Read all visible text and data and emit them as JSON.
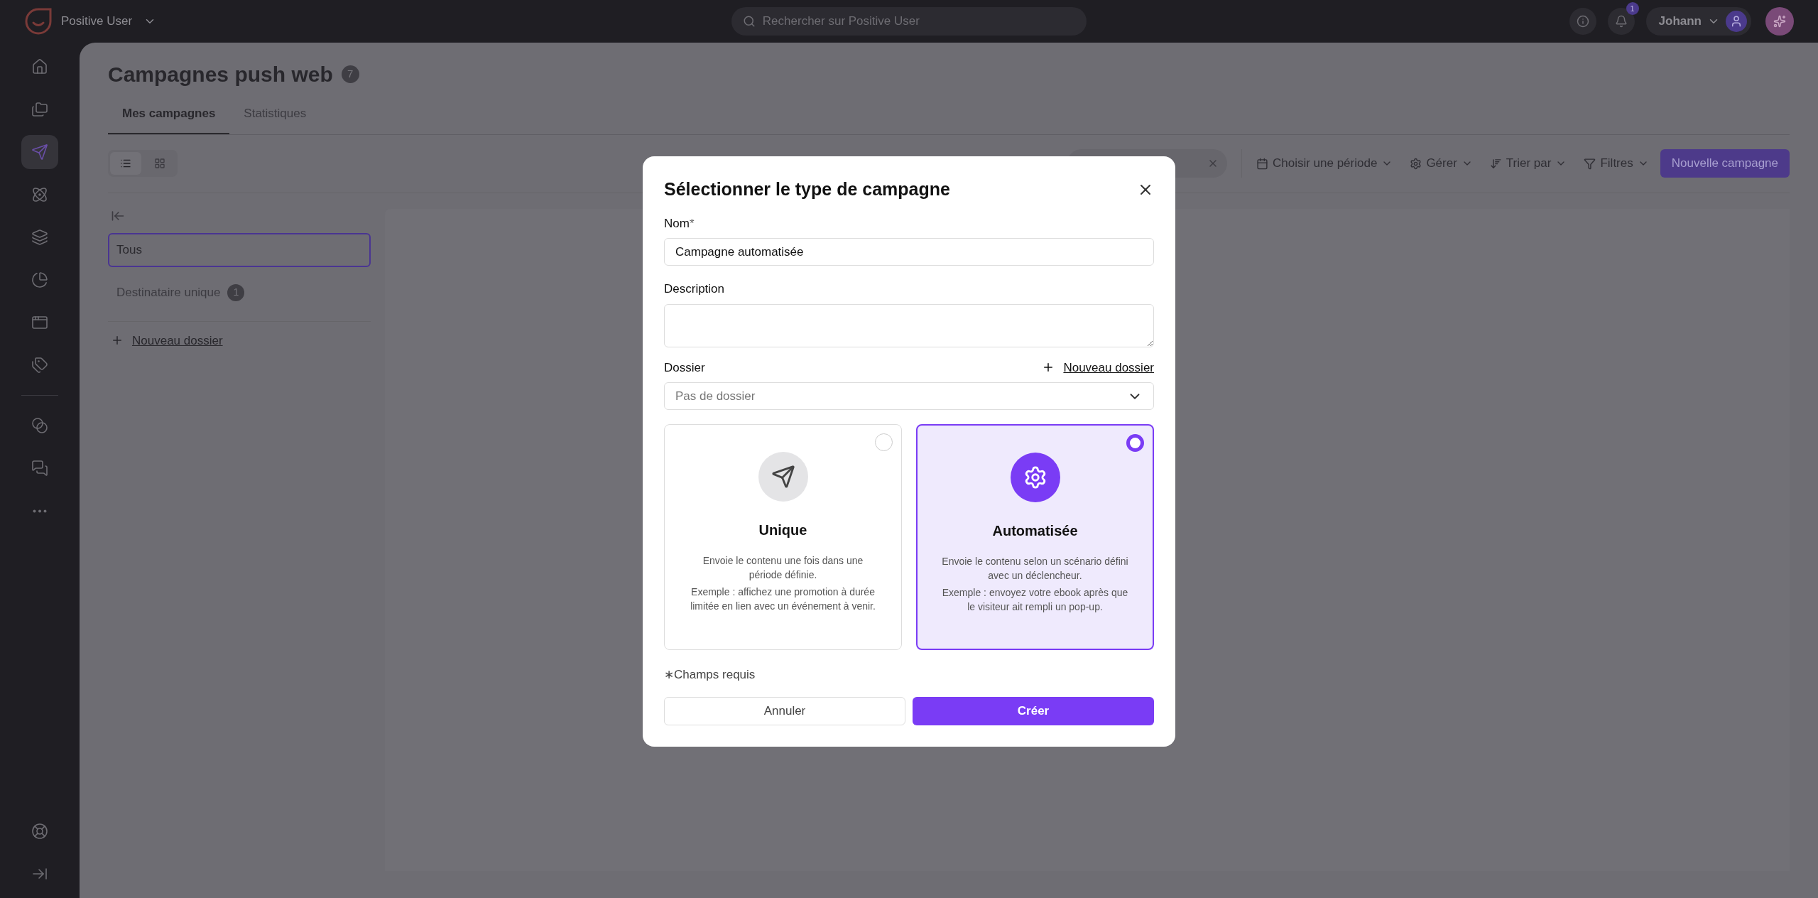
{
  "topbar": {
    "workspace": "Positive User",
    "search": {
      "placeholder": "Rechercher sur Positive User"
    },
    "notifications_badge": "1",
    "user": "Johann"
  },
  "sidebar": {
    "main": [
      {
        "selected": false
      },
      {
        "selected": false
      },
      {
        "selected": true
      },
      {
        "selected": false
      },
      {
        "selected": false
      },
      {
        "selected": false
      },
      {
        "selected": false
      },
      {
        "selected": false
      }
    ],
    "secondary": [
      {
        "selected": false
      },
      {
        "selected": false
      },
      {
        "selected": false
      }
    ],
    "bottom": [
      {
        "selected": false
      },
      {
        "selected": false
      }
    ]
  },
  "page": {
    "title": "Campagnes push web",
    "count": "7",
    "tabs": [
      {
        "label": "Mes campagnes",
        "selected": true
      },
      {
        "label": "Statistiques",
        "selected": false
      }
    ],
    "view_toggle": [
      {
        "selected": true
      },
      {
        "selected": false
      }
    ],
    "toolbar": [
      "Choisir une période",
      "Gérer",
      "Trier par",
      "Filtres"
    ],
    "new_button": "Nouvelle campagne"
  },
  "folders": {
    "items": [
      {
        "label": "Tous",
        "selected": true
      },
      {
        "label": "Destinataire unique",
        "count": "1",
        "selected": false
      }
    ],
    "new_folder": "Nouveau dossier"
  },
  "dialog": {
    "title": "Sélectionner le type de campagne",
    "name_label": "Nom",
    "required_mark": "*",
    "name_value": "Campagne automatisée",
    "description_label": "Description",
    "folder_label": "Dossier",
    "new_folder": "Nouveau dossier",
    "folder_value": "Pas de dossier",
    "cards": [
      {
        "title": "Unique",
        "description": "Envoie le contenu une fois dans une période définie.",
        "example": "Exemple : affichez une promotion à durée limitée en lien avec un événement à venir.",
        "selected": false
      },
      {
        "title": "Automatisée",
        "description": "Envoie le contenu selon un scénario défini avec un déclencheur.",
        "example": "Exemple : envoyez votre ebook après que le visiteur ait rempli un pop-up.",
        "selected": true
      }
    ],
    "note": "∗Champs requis",
    "cancel": "Annuler",
    "create": "Créer"
  }
}
